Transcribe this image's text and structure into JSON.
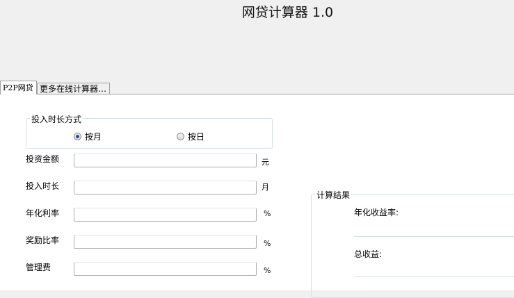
{
  "window": {
    "title": "网贷计算器 1.0"
  },
  "tabs": [
    {
      "label": "P2P网贷",
      "active": true
    },
    {
      "label": "更多在线计算器…",
      "active": false
    }
  ],
  "invest_mode": {
    "legend": "投入时长方式",
    "options": [
      {
        "label": "按月",
        "checked": true
      },
      {
        "label": "按日",
        "checked": false
      }
    ]
  },
  "fields": [
    {
      "label": "投资金额",
      "value": "",
      "unit": "元"
    },
    {
      "label": "投入时长",
      "value": "",
      "unit": "月"
    },
    {
      "label": "年化利率",
      "value": "",
      "unit": "%"
    },
    {
      "label": "奖励比率",
      "value": "",
      "unit": "%"
    },
    {
      "label": "管理费",
      "value": "",
      "unit": "%"
    }
  ],
  "results": {
    "legend": "计算结果",
    "annual_yield_label": "年化收益率:",
    "total_income_label": "总收益:"
  },
  "colors": {
    "accent": "#1f4fa0",
    "border": "#abadb3",
    "tab_border": "#a0a0a0"
  }
}
